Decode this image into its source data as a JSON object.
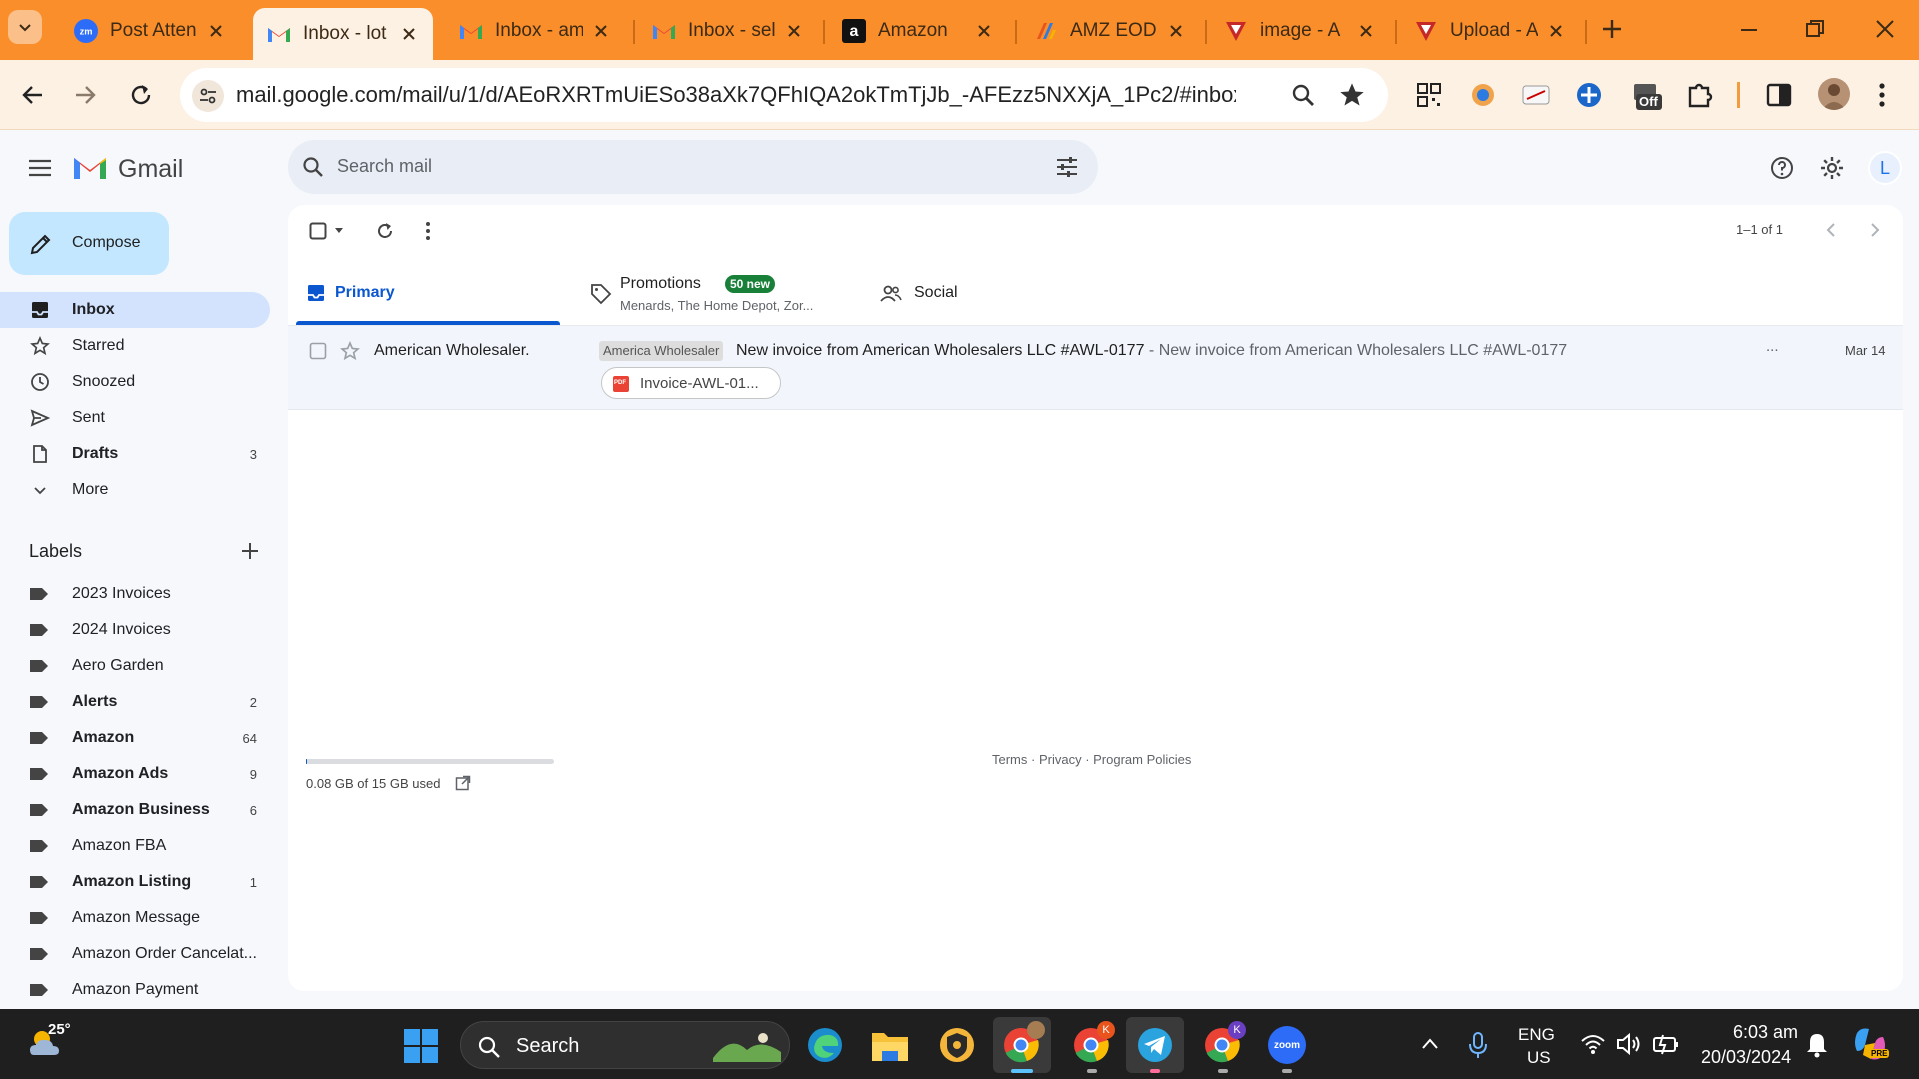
{
  "browser": {
    "tabs": [
      {
        "title": "Post Atten",
        "icon": "zoom-icon"
      },
      {
        "title": "Inbox - lot",
        "icon": "gmail-icon",
        "active": true
      },
      {
        "title": "Inbox - am",
        "icon": "gmail-icon"
      },
      {
        "title": "Inbox - sel",
        "icon": "gmail-icon"
      },
      {
        "title": "Amazon",
        "icon": "amazon-icon"
      },
      {
        "title": "AMZ EOD",
        "icon": "amz-eod-icon"
      },
      {
        "title": "image - A",
        "icon": "shield-logo-icon"
      },
      {
        "title": "Upload - A",
        "icon": "shield-logo-icon"
      }
    ],
    "url": "mail.google.com/mail/u/1/d/AEoRXRTmUiESo38aXk7QFhIQA2okTmTjJb_-AFEzz5NXXjA_1Pc2/#inbox",
    "extension_badge": "Off"
  },
  "gmail": {
    "brand": "Gmail",
    "search_placeholder": "Search mail",
    "compose_label": "Compose",
    "account_initial": "L",
    "nav": [
      {
        "label": "Inbox",
        "count": "",
        "bold": true,
        "active": true,
        "icon": "inbox-icon"
      },
      {
        "label": "Starred",
        "count": "",
        "icon": "star-icon"
      },
      {
        "label": "Snoozed",
        "count": "",
        "icon": "clock-icon"
      },
      {
        "label": "Sent",
        "count": "",
        "icon": "send-icon"
      },
      {
        "label": "Drafts",
        "count": "3",
        "bold": true,
        "icon": "draft-icon"
      },
      {
        "label": "More",
        "count": "",
        "icon": "chevron-down-icon"
      }
    ],
    "labels_heading": "Labels",
    "labels": [
      {
        "label": "2023 Invoices",
        "count": ""
      },
      {
        "label": "2024 Invoices",
        "count": ""
      },
      {
        "label": "Aero Garden",
        "count": ""
      },
      {
        "label": "Alerts",
        "count": "2",
        "bold": true
      },
      {
        "label": "Amazon",
        "count": "64",
        "bold": true
      },
      {
        "label": "Amazon Ads",
        "count": "9",
        "bold": true
      },
      {
        "label": "Amazon Business",
        "count": "6",
        "bold": true
      },
      {
        "label": "Amazon FBA",
        "count": ""
      },
      {
        "label": "Amazon Listing",
        "count": "1",
        "bold": true
      },
      {
        "label": "Amazon Message",
        "count": ""
      },
      {
        "label": "Amazon Order Cancelat...",
        "count": ""
      },
      {
        "label": "Amazon Payment",
        "count": ""
      }
    ],
    "pagination": "1–1 of 1",
    "tabs": {
      "primary": "Primary",
      "promotions": "Promotions",
      "promotions_badge": "50 new",
      "promotions_snippet": "Menards, The Home Depot, Zor...",
      "social": "Social"
    },
    "email": {
      "sender": "American Wholesaler.",
      "label_chip": "America Wholesaler",
      "subject": "New invoice from American Wholesalers LLC #AWL-0177",
      "separator": " - ",
      "snippet": "New invoice from American Wholesalers LLC #AWL-0177",
      "more": "...",
      "date": "Mar 14",
      "attachment": "Invoice-AWL-01...",
      "attachment_type": "PDF"
    },
    "storage": {
      "text": "0.08 GB of 15 GB used",
      "fraction": 0.005
    },
    "footer": {
      "terms": "Terms",
      "dot": " · ",
      "privacy": "Privacy",
      "policies": "Program Policies"
    }
  },
  "taskbar": {
    "weather_temp": "25°",
    "search_label": "Search",
    "language_line1": "ENG",
    "language_line2": "US",
    "time": "6:03 am",
    "date": "20/03/2024",
    "chrome_badge_1": "K",
    "chrome_badge_2": "K",
    "zoom_label": "zoom",
    "copilot_badge": "PRE"
  },
  "colors": {
    "tab_strip": "#f98e2b",
    "toolbar": "#fdf1e4",
    "compose": "#c2e7ff",
    "nav_active": "#d3e3fd",
    "primary_blue": "#0b57d0",
    "promo_badge": "#188038",
    "taskbar": "#1f1f1f"
  }
}
